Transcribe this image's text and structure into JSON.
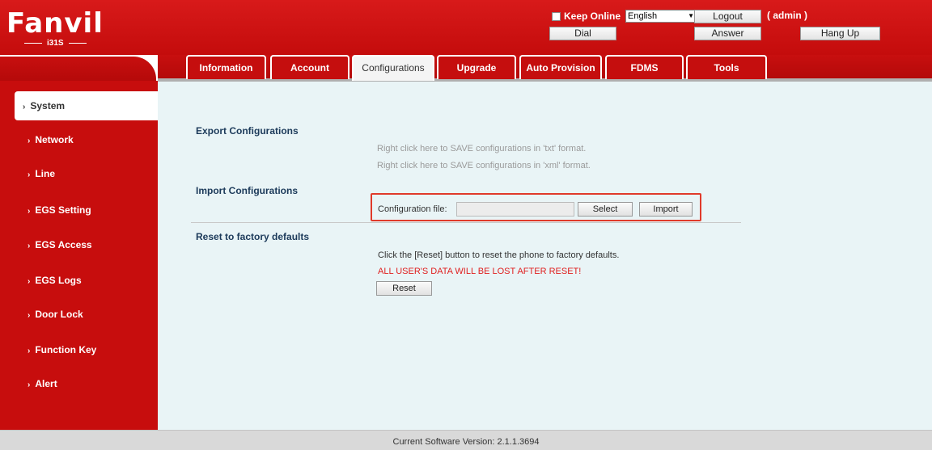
{
  "header": {
    "brand": "Fanvil",
    "model": "i31S",
    "keep_online_label": "Keep Online",
    "language": "English",
    "logout_label": "Logout",
    "dial_label": "Dial",
    "answer_label": "Answer",
    "hangup_label": "Hang Up",
    "user": "( admin )"
  },
  "tabs": [
    {
      "label": "Information"
    },
    {
      "label": "Account"
    },
    {
      "label": "Configurations"
    },
    {
      "label": "Upgrade"
    },
    {
      "label": "Auto Provision"
    },
    {
      "label": "FDMS"
    },
    {
      "label": "Tools"
    }
  ],
  "sidebar": {
    "items": [
      {
        "label": "System"
      },
      {
        "label": "Network"
      },
      {
        "label": "Line"
      },
      {
        "label": "EGS Setting"
      },
      {
        "label": "EGS Access"
      },
      {
        "label": "EGS Logs"
      },
      {
        "label": "Door Lock"
      },
      {
        "label": "Function Key"
      },
      {
        "label": "Alert"
      }
    ]
  },
  "main": {
    "export_title": "Export Configurations",
    "export_txt_hint": "Right click here to SAVE configurations in 'txt' format.",
    "export_xml_hint": "Right click here to SAVE configurations in 'xml' format.",
    "import_title": "Import Configurations",
    "config_file_label": "Configuration file:",
    "select_label": "Select",
    "import_label": "Import",
    "reset_title": "Reset to factory defaults",
    "reset_desc": "Click the [Reset] button to reset the phone to factory defaults.",
    "reset_warning": "ALL USER'S DATA WILL BE LOST AFTER RESET!",
    "reset_label": "Reset"
  },
  "footer": {
    "version": "Current Software Version: 2.1.1.3694"
  },
  "colors": {
    "brand_red": "#c70d0d",
    "highlight_box": "#e03a2a",
    "warning_text": "#e02020",
    "content_bg": "#e9f4f6"
  }
}
